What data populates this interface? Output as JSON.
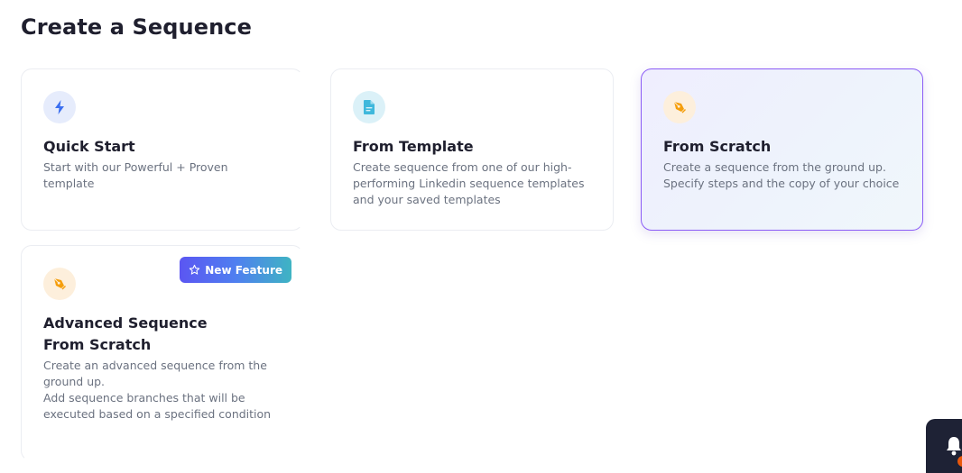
{
  "page": {
    "title": "Create a Sequence"
  },
  "cards": [
    {
      "title": "Quick Start",
      "description": "Start with our Powerful + Proven template",
      "icon": "lightning-icon"
    },
    {
      "title": "From Template",
      "description": "Create sequence from one of our high-performing Linkedin sequence templates and your saved templates",
      "icon": "document-icon"
    },
    {
      "title": "From Scratch",
      "description": "Create a sequence from the ground up. Specify steps and the copy of your choice",
      "icon": "pen-tool-icon",
      "selected": true
    },
    {
      "title": "Advanced Sequence From Scratch",
      "description_lines": [
        "Create an advanced sequence from the ground up.",
        "Add sequence branches that will be executed based on a specified condition"
      ],
      "icon": "pen-tool-icon",
      "badge": "New Feature"
    }
  ],
  "colors": {
    "accent": "#8b5cf6",
    "lightning": "#3b6ff0",
    "lightning_bg": "#e6ecfc",
    "document": "#3fb8dc",
    "document_bg": "#dbf1f8",
    "pen": "#f59e0b",
    "pen_bg": "#fdefdc"
  }
}
